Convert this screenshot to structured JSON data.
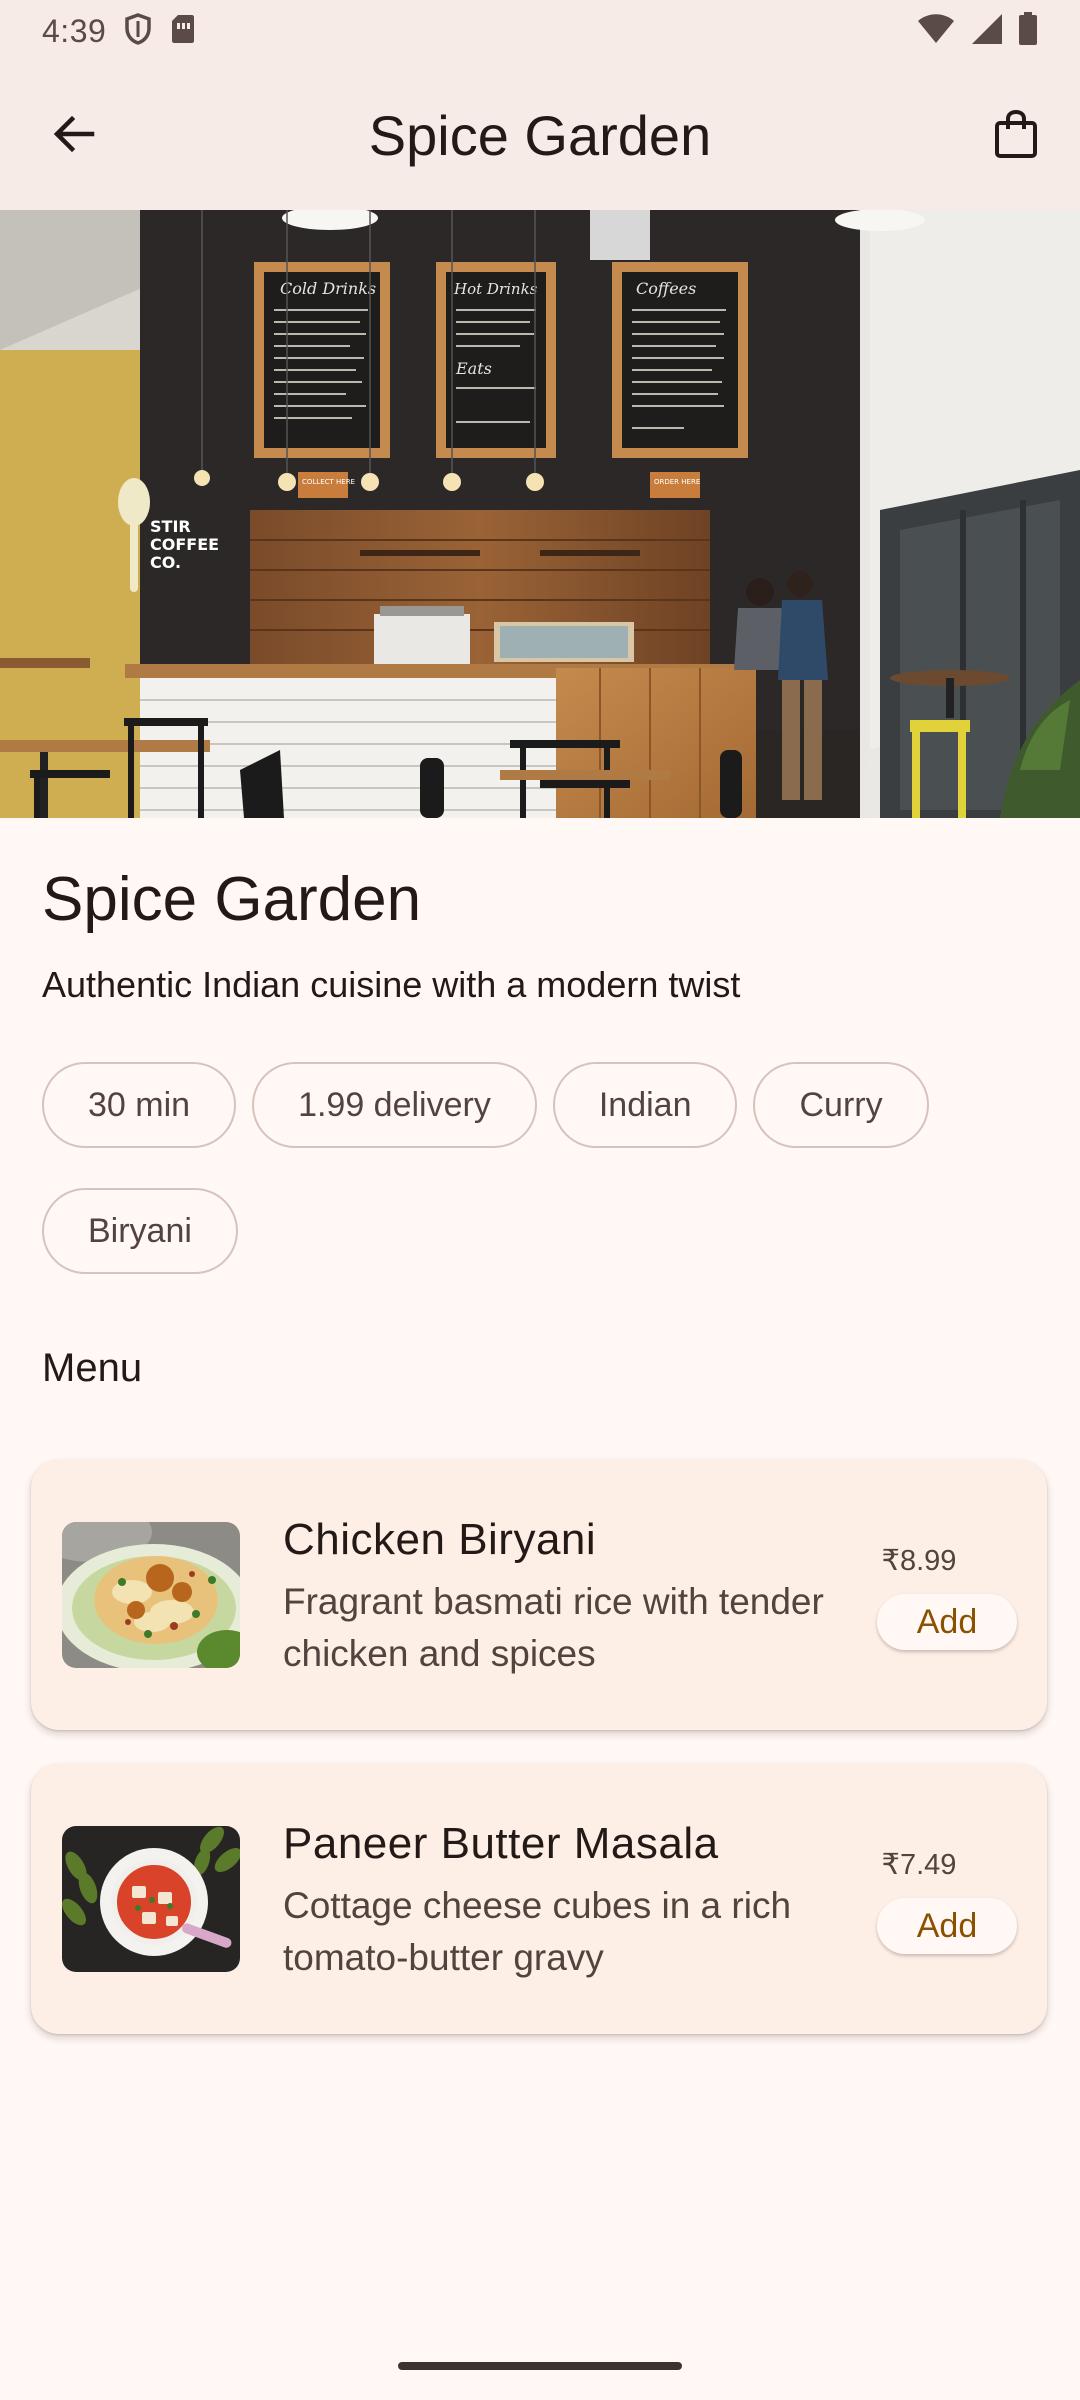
{
  "status_bar": {
    "time": "4:39",
    "icons": [
      "shield-icon",
      "sim-card-icon",
      "wifi-icon",
      "signal-icon",
      "battery-icon"
    ]
  },
  "app_bar": {
    "title": "Spice Garden",
    "back_icon": "arrow-back-icon",
    "cart_icon": "shopping-bag-icon"
  },
  "hero": {
    "signs": {
      "cold": "Cold Drinks",
      "hot": "Hot Drinks",
      "coffees": "Coffees",
      "eats": "Eats",
      "brand": [
        "STIR",
        "COFFEE",
        "CO."
      ],
      "collect": "COLLECT HERE",
      "order": "ORDER HERE"
    }
  },
  "restaurant": {
    "name": "Spice Garden",
    "description": "Authentic Indian cuisine with a modern twist",
    "chips": [
      "30 min",
      "1.99 delivery",
      "Indian",
      "Curry",
      "Biryani"
    ]
  },
  "menu": {
    "heading": "Menu",
    "items": [
      {
        "name": "Chicken Biryani",
        "description": "Fragrant basmati rice with tender chicken and spices",
        "price": "₹8.99",
        "add_label": "Add"
      },
      {
        "name": "Paneer Butter Masala",
        "description": "Cottage cheese cubes in a rich tomato-butter gravy",
        "price": "₹7.49",
        "add_label": "Add"
      }
    ]
  },
  "colors": {
    "background": "#fff8f5",
    "app_bar": "#f6ebe6",
    "card": "#fdeee6",
    "accent": "#8a5100",
    "chip_border": "#d8c2bc"
  }
}
